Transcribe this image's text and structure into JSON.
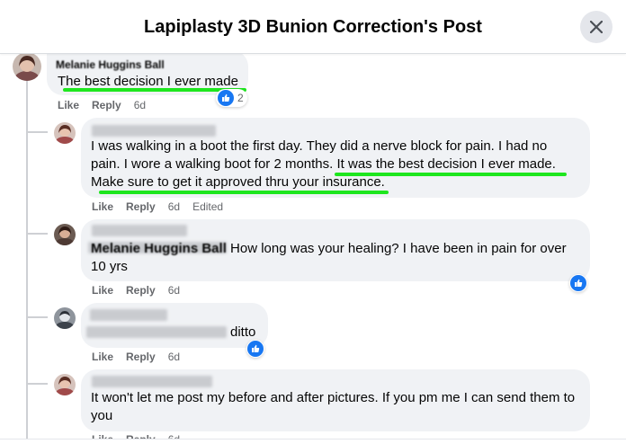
{
  "header": {
    "title": "Lapiplasty 3D Bunion Correction's Post",
    "close_icon": "close-icon"
  },
  "colors": {
    "like_blue": "#1877f2",
    "bubble_bg": "#f0f2f5",
    "highlight_green": "#1ee61e",
    "meta_gray": "#65676b"
  },
  "comments": [
    {
      "author": "Melanie Huggins Ball",
      "text": "The best decision I ever made",
      "like": "Like",
      "reply": "Reply",
      "time": "6d",
      "reaction_count": "2"
    },
    {
      "line1": "I was walking in a boot the first day. They did a nerve block for pain. I had no",
      "line2_a": "pain. I wore a walking boot for 2 months.",
      "line2_b": "It was the best decision I ever made.",
      "line3": "Make sure to get it approved thru your insurance.",
      "like": "Like",
      "reply": "Reply",
      "time": "6d",
      "edited": "Edited"
    },
    {
      "author": "Melanie Huggins Ball",
      "line1": "How long was your healing? I have been in pain for over",
      "line2": "10 yrs",
      "like": "Like",
      "reply": "Reply",
      "time": "6d"
    },
    {
      "text": "ditto",
      "like": "Like",
      "reply": "Reply",
      "time": "6d"
    },
    {
      "line1": "It won't let me post my before and after pictures. If you pm me I can send them to",
      "line2": "you",
      "like": "Like",
      "reply": "Reply",
      "time": "6d"
    }
  ]
}
